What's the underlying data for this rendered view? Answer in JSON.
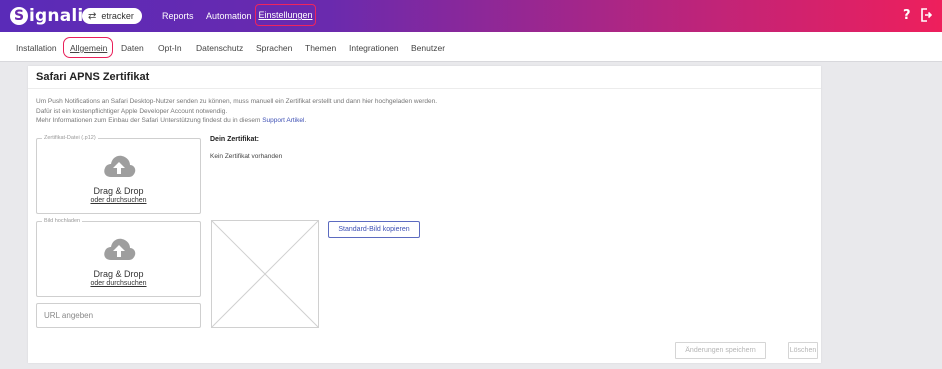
{
  "header": {
    "logo_letter": "S",
    "logo_rest": "ignalize",
    "project": "etracker",
    "project_icon": "swap-arrows-icon",
    "nav": [
      {
        "label": "Reports"
      },
      {
        "label": "Automation"
      },
      {
        "label": "Einstellungen",
        "active": true
      }
    ],
    "help_icon_glyph": "?",
    "colors": {
      "gradient_start": "#5a2bb8",
      "gradient_end": "#ee1f5c",
      "highlight": "#e91f5a"
    }
  },
  "subnav": {
    "items": [
      {
        "label": "Installation"
      },
      {
        "label": "Allgemein",
        "active": true
      },
      {
        "label": "Daten"
      },
      {
        "label": "Opt-In"
      },
      {
        "label": "Datenschutz"
      },
      {
        "label": "Sprachen"
      },
      {
        "label": "Themen"
      },
      {
        "label": "Integrationen"
      },
      {
        "label": "Benutzer"
      }
    ]
  },
  "card": {
    "title": "Safari APNS Zertifikat",
    "description": [
      "Um Push Notifications an Safari Desktop-Nutzer senden zu können, muss manuell ein Zertifikat erstellt und dann hier hochgeladen werden.",
      "Dafür ist ein kostenpflichtiger Apple Developer Account notwendig."
    ],
    "description_link_prefix": "Mehr Informationen zum Einbau der Safari Unterstützung findest du in diesem ",
    "description_link_text": "Support Artikel",
    "description_link_suffix": ".",
    "cert_upload": {
      "legend": "Zertifikat-Datei (.p12)",
      "title": "Drag & Drop",
      "sub": "oder durchsuchen"
    },
    "image_upload": {
      "legend": "Bild hochladen",
      "title": "Drag & Drop",
      "sub": "oder durchsuchen"
    },
    "cert_label": "Dein Zertifikat:",
    "cert_value": "Kein Zertifikat vorhanden",
    "std_image_button": "Standard-Bild kopieren",
    "url_placeholder": "URL angeben",
    "save_button": "Änderungen speichern",
    "delete_button": "Löschen"
  }
}
